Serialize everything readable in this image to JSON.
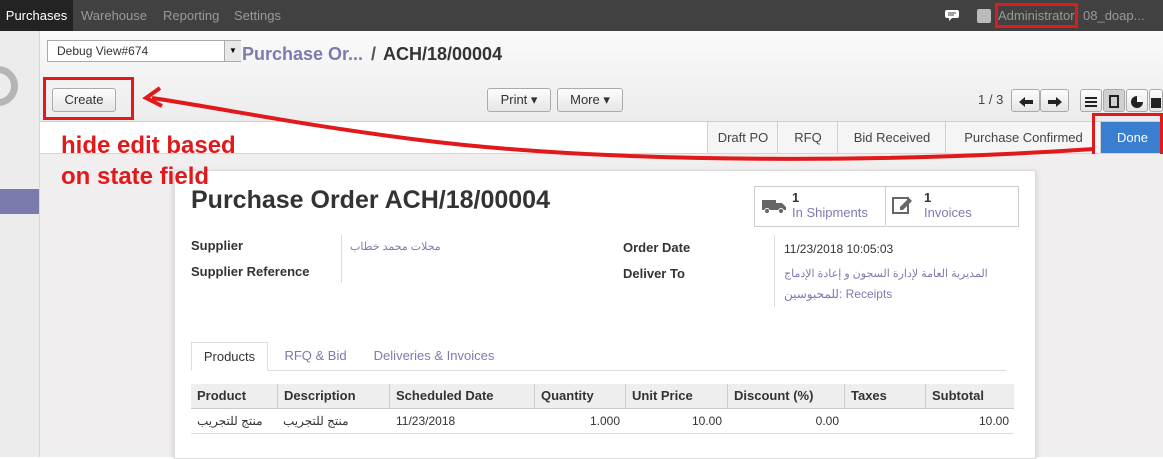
{
  "topnav": {
    "items": [
      "Purchases",
      "Warehouse",
      "Reporting",
      "Settings"
    ],
    "user": "Administrator",
    "db": "08_doap..."
  },
  "control": {
    "debug_select": "Debug View#674",
    "breadcrumb_parent": "Purchase Or...",
    "breadcrumb_sep": "/",
    "breadcrumb_current": "ACH/18/00004",
    "create_label": "Create",
    "print_label": "Print ▾",
    "more_label": "More ▾",
    "pager": "1 / 3"
  },
  "statusbar": {
    "stages": [
      "Draft PO",
      "RFQ",
      "Bid Received",
      "Purchase Confirmed",
      "Done"
    ],
    "active": "Done"
  },
  "annotation": {
    "line1": "hide edit based",
    "line2": "on state field",
    "color": "#e2191b"
  },
  "form": {
    "title": "Purchase Order ACH/18/00004",
    "shipments_count": "1",
    "shipments_label": "In Shipments",
    "invoices_count": "1",
    "invoices_label": "Invoices",
    "supplier_label": "Supplier",
    "supplier_ref_label": "Supplier Reference",
    "supplier_value": "محلات محمد خطاب",
    "order_date_label": "Order Date",
    "order_date_value": "11/23/2018 10:05:03",
    "deliver_to_label": "Deliver To",
    "deliver_to_line1": "المديرية العامة لإدارة السجون و إعادة الإدماج",
    "deliver_to_line2": "للمحبوسين: Receipts"
  },
  "tabs": [
    "Products",
    "RFQ & Bid",
    "Deliveries & Invoices"
  ],
  "table": {
    "headers": [
      "Product",
      "Description",
      "Scheduled Date",
      "Quantity",
      "Unit Price",
      "Discount (%)",
      "Taxes",
      "Subtotal"
    ],
    "rows": [
      {
        "product": "منتج للتجريب",
        "description": "منتج للتجريب",
        "date": "11/23/2018",
        "quantity": "1.000",
        "unit_price": "10.00",
        "discount": "0.00",
        "taxes": "",
        "subtotal": "10.00"
      }
    ]
  }
}
